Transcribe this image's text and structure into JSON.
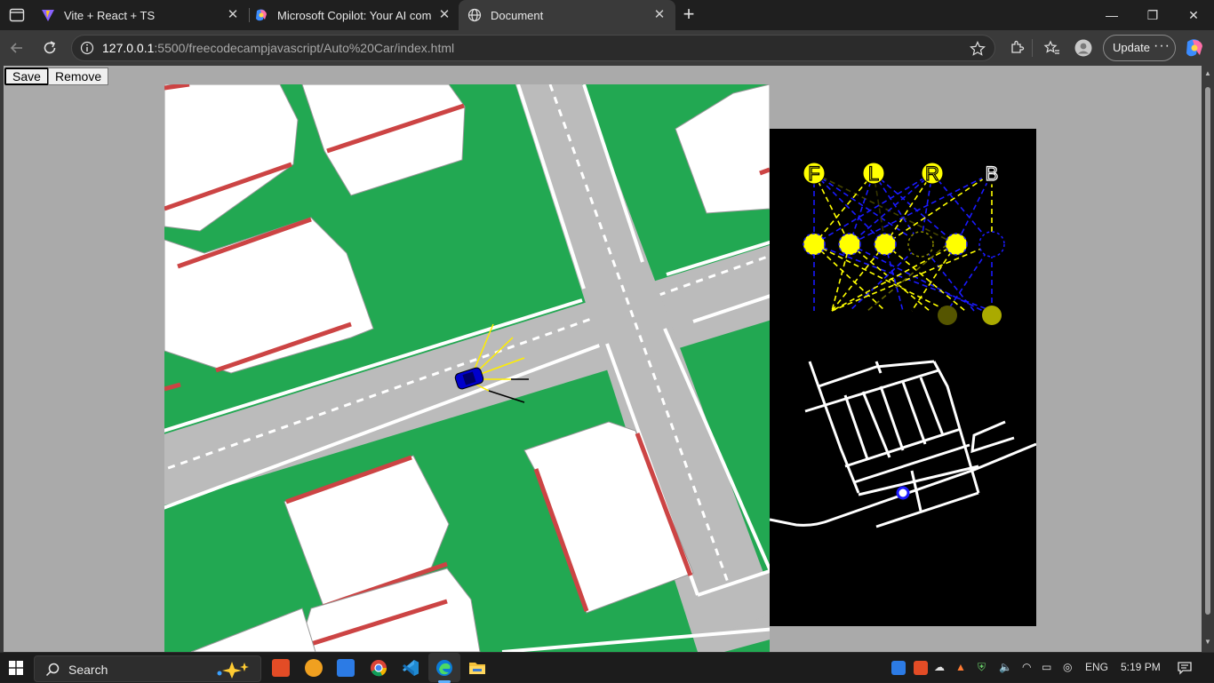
{
  "browser": {
    "tabs": [
      {
        "label": "Vite + React + TS",
        "active": false
      },
      {
        "label": "Microsoft Copilot: Your AI compa",
        "active": false
      },
      {
        "label": "Document",
        "active": true
      }
    ],
    "new_tab_glyph": "+",
    "window_controls": {
      "minimize": "—",
      "restore": "❐",
      "close": "✕"
    },
    "url_host": "127.0.0.1",
    "url_rest": ":5500/freecodecampjavascript/Auto%20Car/index.html",
    "update_label": "Update",
    "more_glyph": "···"
  },
  "page": {
    "save_label": "Save",
    "remove_label": "Remove",
    "network": {
      "output_labels": [
        "F",
        "L",
        "R",
        "B"
      ]
    }
  },
  "taskbar": {
    "search_label": "Search",
    "language": "ENG",
    "time": "5:19 PM"
  },
  "colors": {
    "grass": "#22a852",
    "road": "#bbbbbb",
    "building": "#ffffff",
    "roof_edge": "#cc4444",
    "car": "#0000cc",
    "sensor": "#ffee00",
    "network_bg": "#000000",
    "network_active": "#ffff00",
    "network_negative": "#0000ff"
  }
}
